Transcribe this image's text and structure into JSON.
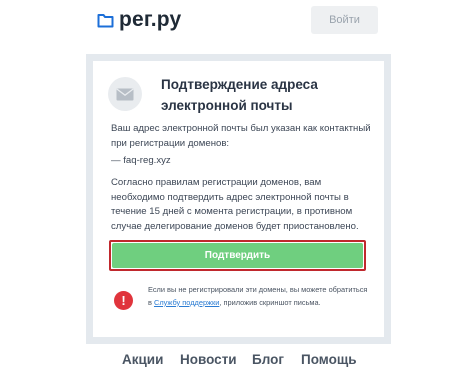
{
  "header": {
    "logo_text": "рег.ру",
    "login_label": "Войти"
  },
  "card": {
    "title_line1": "Подтверждение адреса",
    "title_line2": "электронной почты",
    "para1": "Ваш адрес электронной почты был указан как контактный при регистрации доменов:",
    "email_line": "— faq-reg.xyz",
    "para2": "Согласно правилам регистрации доменов, вам необходимо подтвердить адрес электронной почты в течение 15 дней с момента регистрации, в противном случае делегирование доменов будет приостановлено.",
    "confirm_label": "Подтвердить",
    "note_before": "Если вы не регистрировали эти домены, вы можете обратиться в ",
    "note_link": "Службу поддержки",
    "note_after": ", приложив скриншот письма."
  },
  "footer": {
    "links": [
      "Акции",
      "Новости",
      "Блог",
      "Помощь"
    ]
  },
  "colors": {
    "accent_blue": "#2b7cd3",
    "confirm_green": "#6fcf7f",
    "highlight_red": "#c0282d",
    "alert_red": "#e0343c"
  }
}
